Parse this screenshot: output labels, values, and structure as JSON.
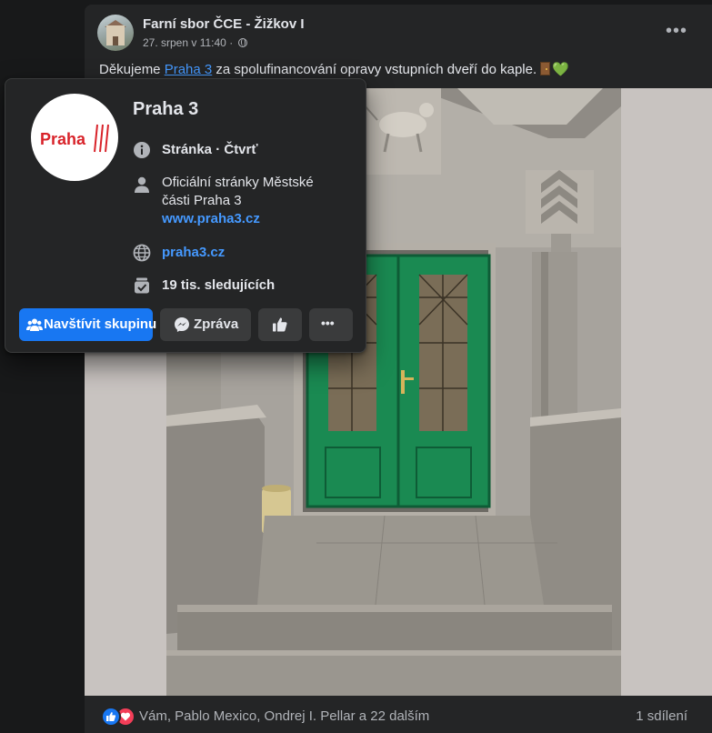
{
  "post": {
    "page_name": "Farní sbor ČCE - Žižkov I",
    "date": "27. srpen v 11:40",
    "separator": "·",
    "more_menu": "•••",
    "text_before_link": "Děkujeme ",
    "text_link": "Praha 3",
    "text_after_link": " za spolufinancování opravy vstupních dveří do kaple.",
    "emoji_heart": "💚"
  },
  "hovercard": {
    "title": "Praha 3",
    "logo_text": "Praha",
    "type_label": "Stránka · Čtvrť",
    "description": "Oficiální stránky Městské části Praha 3",
    "description_link": "www.praha3.cz",
    "website": "praha3.cz",
    "followers": "19 tis. sledujících",
    "buttons": {
      "visit": "Navštívit skupinu",
      "message": "Zpráva",
      "more": "•••"
    }
  },
  "footer": {
    "reactions": "Vám, Pablo Mexico, Ondrej I. Pellar a 22 dalším",
    "shares": "1 sdílení"
  },
  "colors": {
    "background": "#18191a",
    "card": "#242526",
    "link": "#4599ff",
    "primary_button": "#1877f2",
    "secondary_button": "#3a3b3c",
    "door_green": "#1a8a52",
    "logo_red": "#d8232a"
  }
}
